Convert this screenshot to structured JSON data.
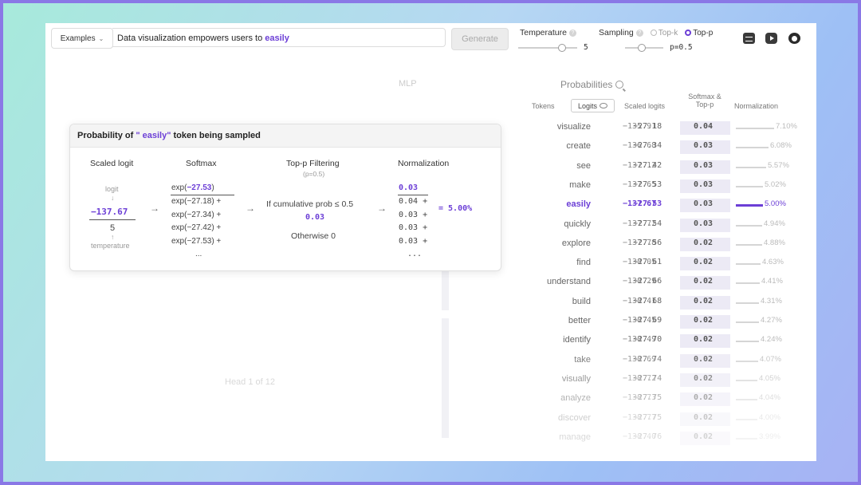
{
  "toolbar": {
    "examples_label": "Examples",
    "prompt_text": "Data visualization empowers users to",
    "prompt_token": "easily",
    "generate_label": "Generate",
    "temperature_label": "Temperature",
    "temperature_value": "5",
    "sampling_label": "Sampling",
    "topk_label": "Top-k",
    "topp_label": "Top-p",
    "topp_value": "p=0.5",
    "sampling_selected": "Top-p",
    "icons": [
      "database-icon",
      "youtube-icon",
      "github-icon"
    ]
  },
  "background": {
    "mlp_label": "MLP",
    "head_label": "Head 1 of 12"
  },
  "probabilities": {
    "title": "Probabilities",
    "col_tokens": "Tokens",
    "col_logits": "Logits",
    "col_scaled": "Scaled logits",
    "col_softmax_1": "Softmax &",
    "col_softmax_2": "Top-p",
    "col_norm": "Normalization",
    "rows": [
      {
        "token": "visualize",
        "logit": "−135.91",
        "scaled": "−27.18",
        "soft": "0.04",
        "norm": "7.10%",
        "pct": 7.1
      },
      {
        "token": "create",
        "logit": "−136.68",
        "scaled": "−27.34",
        "soft": "0.03",
        "norm": "6.08%",
        "pct": 6.08
      },
      {
        "token": "see",
        "logit": "−137.12",
        "scaled": "−27.42",
        "soft": "0.03",
        "norm": "5.57%",
        "pct": 5.57
      },
      {
        "token": "make",
        "logit": "−137.65",
        "scaled": "−27.53",
        "soft": "0.03",
        "norm": "5.02%",
        "pct": 5.02
      },
      {
        "token": "easily",
        "logit": "−137.67",
        "scaled": "−27.53",
        "soft": "0.03",
        "norm": "5.00%",
        "pct": 5.0
      },
      {
        "token": "quickly",
        "logit": "−137.72",
        "scaled": "−27.54",
        "soft": "0.03",
        "norm": "4.94%",
        "pct": 4.94
      },
      {
        "token": "explore",
        "logit": "−137.78",
        "scaled": "−27.56",
        "soft": "0.02",
        "norm": "4.88%",
        "pct": 4.88
      },
      {
        "token": "find",
        "logit": "−138.05",
        "scaled": "−27.61",
        "soft": "0.02",
        "norm": "4.63%",
        "pct": 4.63
      },
      {
        "token": "understand",
        "logit": "−138.29",
        "scaled": "−27.66",
        "soft": "0.02",
        "norm": "4.41%",
        "pct": 4.41
      },
      {
        "token": "build",
        "logit": "−138.41",
        "scaled": "−27.68",
        "soft": "0.02",
        "norm": "4.31%",
        "pct": 4.31
      },
      {
        "token": "better",
        "logit": "−138.45",
        "scaled": "−27.69",
        "soft": "0.02",
        "norm": "4.27%",
        "pct": 4.27
      },
      {
        "token": "identify",
        "logit": "−138.49",
        "scaled": "−27.70",
        "soft": "0.02",
        "norm": "4.24%",
        "pct": 4.24
      },
      {
        "token": "take",
        "logit": "−138.69",
        "scaled": "−27.74",
        "soft": "0.02",
        "norm": "4.07%",
        "pct": 4.07
      },
      {
        "token": "visually",
        "logit": "−138.72",
        "scaled": "−27.74",
        "soft": "0.02",
        "norm": "4.05%",
        "pct": 4.05
      },
      {
        "token": "analyze",
        "logit": "−138.73",
        "scaled": "−27.75",
        "soft": "0.02",
        "norm": "4.04%",
        "pct": 4.04
      },
      {
        "token": "discover",
        "logit": "−138.77",
        "scaled": "−27.75",
        "soft": "0.02",
        "norm": "4.00%",
        "pct": 4.0
      },
      {
        "token": "manage",
        "logit": "−138.40",
        "scaled": "−27.76",
        "soft": "0.02",
        "norm": "3.99%",
        "pct": 3.99
      }
    ],
    "selected_token": "easily"
  },
  "popup": {
    "title_prefix": "Probability of",
    "title_token": "\" easily\"",
    "title_suffix": "token being sampled",
    "scaled_logit_header": "Scaled logit",
    "logit_label": "logit",
    "logit_value": "−137.67",
    "temperature_value": "5",
    "temperature_label": "temperature",
    "softmax_header": "Softmax",
    "softmax_numerator": "exp(−27.53)",
    "softmax_terms": [
      "exp(−27.18) +",
      "exp(−27.34) +",
      "exp(−27.42) +",
      "exp(−27.53) +",
      "..."
    ],
    "topp_header": "Top-p Filtering",
    "topp_sub": "(p=0.5)",
    "topp_condition": "If cumulative prob ≤ 0.5",
    "topp_value": "0.03",
    "topp_otherwise": "Otherwise 0",
    "norm_header": "Normalization",
    "norm_numerator": "0.03",
    "norm_terms": [
      "0.04 +",
      "0.03 +",
      "0.03 +",
      "0.03 +",
      "..."
    ],
    "norm_result": "= 5.00%"
  },
  "colors": {
    "accent": "#6c3fd6",
    "border": "#8a78e6"
  }
}
